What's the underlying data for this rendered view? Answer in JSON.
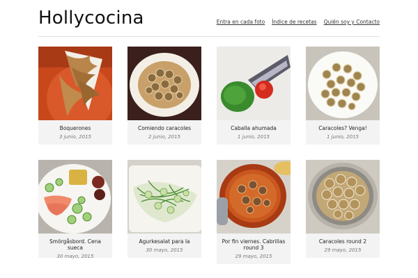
{
  "site": {
    "title": "Hollycocina"
  },
  "nav": [
    {
      "label": "Entra en cada foto"
    },
    {
      "label": "Índice de recetas"
    },
    {
      "label": "Quién soy y Contacto"
    }
  ],
  "posts": [
    {
      "title": "Boquerones",
      "date": "3 junio, 2015",
      "image": "fried anchovies in paper cone"
    },
    {
      "title": "Comiendo caracoles",
      "date": "2 junio, 2015",
      "image": "plate of snails"
    },
    {
      "title": "Caballa ahumada",
      "date": "1 junio, 2015",
      "image": "smoked mackerel with green sauce"
    },
    {
      "title": "Caracoles? Venga!",
      "date": "1 junio, 2015",
      "image": "plate of snails"
    },
    {
      "title": "Smörgåsbord. Cena sueca",
      "date": "30 mayo, 2015",
      "image": "smoked salmon and salad plate"
    },
    {
      "title": "Agurkesalat para la",
      "date": "30 mayo, 2015",
      "image": "cucumber dill salad"
    },
    {
      "title": "Por fin viernes. Cabrillas round 3",
      "date": "29 mayo, 2015",
      "image": "snails in red sauce"
    },
    {
      "title": "Caracoles round 2",
      "date": "29 mayo, 2015",
      "image": "bowl of snails"
    }
  ]
}
